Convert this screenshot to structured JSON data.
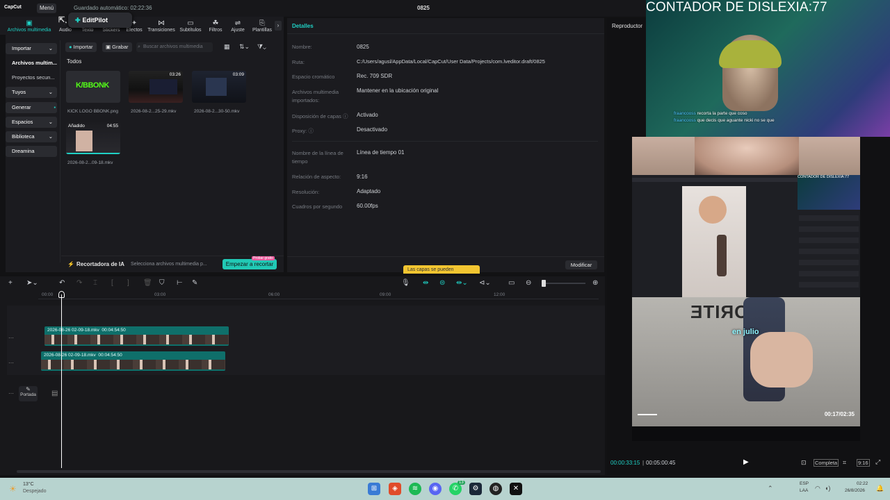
{
  "app": {
    "logo": "CapCut",
    "menu_label": "Menú",
    "autosave": "Guardado automático: 02:22:36",
    "project_title": "0825"
  },
  "toolbar": {
    "tools": [
      {
        "label": "Archivos multimedia",
        "icon": "media-icon"
      },
      {
        "label": "Audio",
        "icon": "audio-icon"
      },
      {
        "label": "Texto",
        "icon": "text-icon"
      },
      {
        "label": "Stickers",
        "icon": "sticker-icon"
      },
      {
        "label": "Efectos",
        "icon": "effects-icon"
      },
      {
        "label": "Transiciones",
        "icon": "transitions-icon"
      },
      {
        "label": "Subtítulos",
        "icon": "subtitles-icon"
      },
      {
        "label": "Filtros",
        "icon": "filters-icon"
      },
      {
        "label": "Ajuste",
        "icon": "adjust-icon"
      },
      {
        "label": "Plantillas",
        "icon": "templates-icon"
      }
    ],
    "editpilot_label": "EditPilot"
  },
  "leftnav": {
    "items": [
      "Importar",
      "Archivos multim...",
      "Proyectos secun...",
      "Tuyos",
      "Generar",
      "Espacios",
      "Biblioteca",
      "Dreamina"
    ]
  },
  "media": {
    "import_label": "Importar",
    "record_label": "Grabar",
    "search_placeholder": "Buscar archivos multimedia",
    "section_label": "Todos",
    "items": [
      {
        "name": "KICK LOGO BBONK.png",
        "duration": "",
        "logo_text": "K/BBONK"
      },
      {
        "name": "2026-08-2...25-29.mkv",
        "duration": "03:26"
      },
      {
        "name": "2026-08-2...30-50.mkv",
        "duration": "03:09"
      },
      {
        "name": "2026-08-2...09-18.mkv",
        "duration": "04:55",
        "badge": "Añadido"
      }
    ],
    "ai_label": "Recortadora de IA",
    "ai_hint": "Selecciona archivos multimedia p...",
    "ai_button": "Empezar a recortar",
    "ai_badge": "Probar gratis"
  },
  "details": {
    "header": "Detalles",
    "rows": [
      {
        "label": "Nombre:",
        "value": "0825"
      },
      {
        "label": "Ruta:",
        "value": "C:/Users/agusl/AppData/Local/CapCut/User Data/Projects/com.lveditor.draft/0825"
      },
      {
        "label": "Espacio cromático",
        "value": "Rec. 709 SDR"
      },
      {
        "label": "Archivos multimedia importados:",
        "value": "Mantener en la ubicación original"
      },
      {
        "label": "Disposición de capas",
        "value": "Activado"
      },
      {
        "label": "Proxy:",
        "value": "Desactivado"
      },
      {
        "label": "Nombre de la línea de tiempo",
        "value": "Línea de tiempo 01"
      },
      {
        "label": "Relación de aspecto:",
        "value": "9:16"
      },
      {
        "label": "Resolución:",
        "value": "Adaptado"
      },
      {
        "label": "Cuadros por segundo",
        "value": "60.00fps"
      }
    ],
    "tooltip": "Las capas se pueden",
    "modify_button": "Modificar"
  },
  "timeline": {
    "ruler": [
      "00:00",
      "03:00",
      "06:00",
      "09:00",
      "12:00"
    ],
    "clips": [
      {
        "name": "2026-08-26 02-09-18.mkv",
        "duration": "00:04:54:50"
      },
      {
        "name": "2026-08-26 02-09-18.mkv",
        "duration": "00:04:54:50"
      }
    ],
    "cover_label": "Portada"
  },
  "player": {
    "header": "Reproductor",
    "counter": "CONTADOR DE DISLEXIA:77",
    "chat": [
      {
        "user": "fraancooss",
        "msg": "recorta la parte que coso"
      },
      {
        "user": "fraancooss",
        "msg": "que decis que aguante nicki no se que"
      }
    ],
    "overlay_mid_title": "CONTADOR DE DISLEXIA:77",
    "caption": "en julio",
    "shirt_text": "ƎTIЯO",
    "inner_time": "00:17/02:35",
    "current_time": "00:00:33:15",
    "total_time": "00:05:00:45",
    "view_label": "Completa",
    "ratio_label": "9:16"
  },
  "taskbar": {
    "weather_temp": "13°C",
    "weather_desc": "Despejado",
    "lang_top": "ESP",
    "lang_bottom": "LAA",
    "time": "02:22",
    "date": "26/8/2026",
    "whatsapp_badge": "13"
  },
  "colors": {
    "accent": "#1fd1c5",
    "clip": "#0f6f6a",
    "cta": "#21c9b5",
    "tooltip": "#f2c531"
  }
}
